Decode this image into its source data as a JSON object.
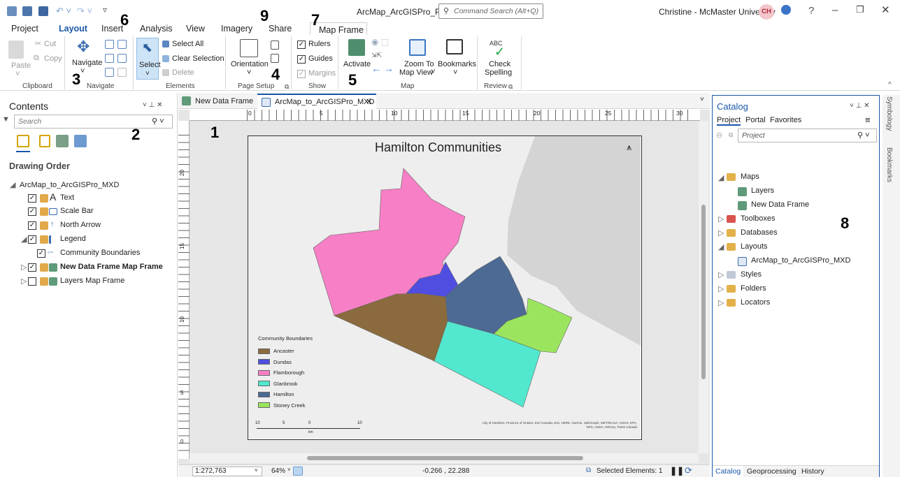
{
  "titlebar": {
    "app_title": "ArcMap_ArcGISPro_PRO",
    "search_placeholder": "Command Search (Alt+Q)",
    "user": "Christine - McMaster University",
    "initials": "CH",
    "help": "?"
  },
  "tabs": [
    "Project",
    "Layout",
    "Insert",
    "Analysis",
    "View",
    "Imagery",
    "Share",
    "Map Frame"
  ],
  "ribbon": {
    "clipboard": {
      "paste": "Paste",
      "cut": "Cut",
      "copy": "Copy",
      "group": "Clipboard"
    },
    "navigate": {
      "navigate": "Navigate",
      "group": "Navigate"
    },
    "elements": {
      "select": "Select",
      "select_all": "Select All",
      "clear_selection": "Clear Selection",
      "delete": "Delete",
      "group": "Elements"
    },
    "page_setup": {
      "orientation": "Orientation",
      "group": "Page Setup"
    },
    "show": {
      "rulers": "Rulers",
      "guides": "Guides",
      "margins": "Margins",
      "group": "Show"
    },
    "map": {
      "activate": "Activate",
      "zoom_to": "Zoom To",
      "map_view": "Map View",
      "bookmarks": "Bookmarks",
      "group": "Map"
    },
    "review": {
      "abc": "ABC",
      "check": "Check",
      "spelling": "Spelling",
      "group": "Review"
    }
  },
  "annotations": [
    "1",
    "2",
    "3",
    "4",
    "5",
    "6",
    "7",
    "8",
    "9"
  ],
  "contents": {
    "title": "Contents",
    "search_placeholder": "Search",
    "drawing_order": "Drawing Order",
    "items": [
      {
        "label": "ArcMap_to_ArcGISPro_MXD"
      },
      {
        "label": "Text"
      },
      {
        "label": "Scale Bar"
      },
      {
        "label": "North Arrow"
      },
      {
        "label": "Legend"
      },
      {
        "label": "Community Boundaries"
      },
      {
        "label": "New Data Frame Map Frame"
      },
      {
        "label": "Layers Map Frame"
      }
    ],
    "text_glyph": "A"
  },
  "doc_tabs": [
    {
      "label": "New Data Frame"
    },
    {
      "label": "ArcMap_to_ArcGISPro_MXD"
    }
  ],
  "ruler": {
    "h_ticks": [
      "0",
      "5",
      "10",
      "15",
      "20",
      "25",
      "30"
    ],
    "v_ticks": [
      "20",
      "15",
      "10",
      "5",
      "0"
    ]
  },
  "layout": {
    "map_title": "Hamilton Communities",
    "legend_title": "Community Boundaries",
    "legend": [
      {
        "name": "Ancaster",
        "color": "#8b6b3d"
      },
      {
        "name": "Dundas",
        "color": "#4f4ee0"
      },
      {
        "name": "Flamborough",
        "color": "#f77fc5"
      },
      {
        "name": "Glanbrook",
        "color": "#52e8cf"
      },
      {
        "name": "Hamilton",
        "color": "#4c6a94"
      },
      {
        "name": "Stoney Creek",
        "color": "#9ae55d"
      }
    ],
    "scalebar_labels": [
      "10",
      "5",
      "0",
      "10"
    ],
    "scalebar_unit": "km",
    "attribution1": "City of Hamilton, Province of Ontario, Esri Canada, Esri, HERE, Garmin, SafeGraph, METI/NASA, USGS, EPA,",
    "attribution2": "NPS, USDA, NRCan, Parks Canada"
  },
  "statusbar": {
    "scale": "1:272,763",
    "zoom": "64%",
    "coords": "-0.266 , 22.288",
    "selected": "Selected Elements: 1"
  },
  "catalog": {
    "title": "Catalog",
    "tabs": [
      "Project",
      "Portal",
      "Favorites"
    ],
    "path": "Project",
    "items": [
      {
        "label": "Maps"
      },
      {
        "label": "Layers"
      },
      {
        "label": "New Data Frame"
      },
      {
        "label": "Toolboxes"
      },
      {
        "label": "Databases"
      },
      {
        "label": "Layouts"
      },
      {
        "label": "ArcMap_to_ArcGISPro_MXD"
      },
      {
        "label": "Styles"
      },
      {
        "label": "Folders"
      },
      {
        "label": "Locators"
      }
    ],
    "bottom_tabs": [
      "Catalog",
      "Geoprocessing",
      "History"
    ]
  },
  "side_tabs": [
    "Symbology",
    "Bookmarks"
  ],
  "colors": {
    "accent": "#1a56a8",
    "selection": "#cde4f7",
    "water": "#d4d4d4",
    "land": "#eeeeee",
    "initials_bg": "#f3c6cc"
  }
}
